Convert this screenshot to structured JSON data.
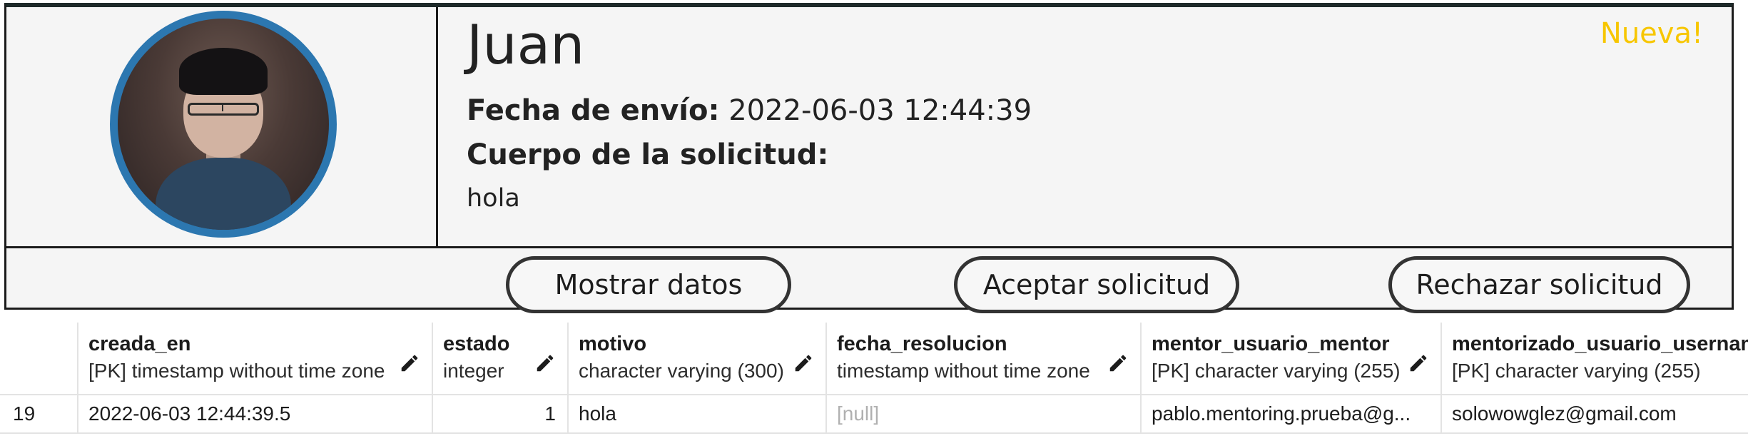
{
  "request": {
    "name": "Juan",
    "badge": "Nueva!",
    "fecha_label": "Fecha de envío:",
    "fecha_value": "2022-06-03 12:44:39",
    "cuerpo_label": "Cuerpo de la solicitud:",
    "cuerpo_value": "hola",
    "buttons": {
      "show": "Mostrar datos",
      "accept": "Aceptar solicitud",
      "reject": "Rechazar solicitud"
    }
  },
  "table": {
    "columns": [
      {
        "name": "creada_en",
        "type": "[PK] timestamp without time zone"
      },
      {
        "name": "estado",
        "type": "integer"
      },
      {
        "name": "motivo",
        "type": "character varying (300)"
      },
      {
        "name": "fecha_resolucion",
        "type": "timestamp without time zone"
      },
      {
        "name": "mentor_usuario_mentor",
        "type": "[PK] character varying (255)"
      },
      {
        "name": "mentorizado_usuario_usernam",
        "type": "[PK] character varying (255)"
      }
    ],
    "rows": [
      {
        "rownum": "19",
        "cells": [
          "2022-06-03 12:44:39.5",
          "1",
          "hola",
          "[null]",
          "pablo.mentoring.prueba@g...",
          "solowowglez@gmail.com"
        ]
      }
    ]
  },
  "colors": {
    "accent": "#2c77b0",
    "badge": "#f7c600",
    "border": "#1b1b1b"
  }
}
